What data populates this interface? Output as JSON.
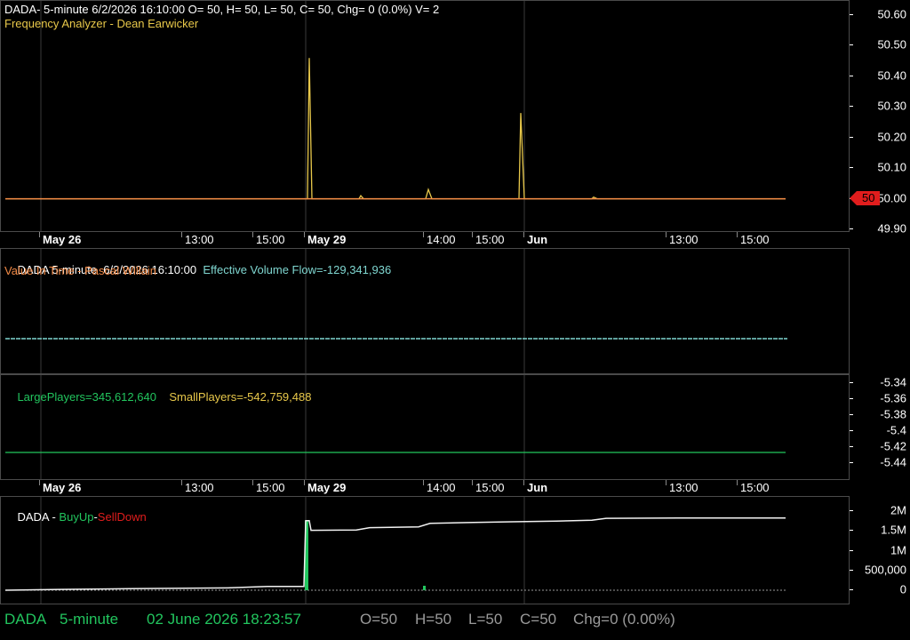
{
  "colors": {
    "green": "#22c55e",
    "yellow": "#e8c84a",
    "orange": "#f28a46",
    "cyan": "#7fd6d0",
    "red": "#e11d1d",
    "gray": "#9a9a9a"
  },
  "panel1": {
    "header": "DADA- 5-minute 6/2/2026 16:10:00 O= 50, H= 50, L= 50, C= 50, Chg= 0 (0.0%) V= 2",
    "subtitle": "Frequency Analyzer - Dean Earwicker",
    "last_value": "50"
  },
  "time_axis": {
    "labels": [
      {
        "text": "May 26",
        "bold": true
      },
      {
        "text": "13:00",
        "bold": false
      },
      {
        "text": "15:00",
        "bold": false
      },
      {
        "text": "May 29",
        "bold": true
      },
      {
        "text": "14:00",
        "bold": false
      },
      {
        "text": "15:00",
        "bold": false
      },
      {
        "text": "Jun",
        "bold": true
      },
      {
        "text": "13:00",
        "bold": false
      },
      {
        "text": "15:00",
        "bold": false
      }
    ]
  },
  "panel2": {
    "header_a": "DADA 5-minute  6/2/2026 16:10:00",
    "header_b": "Effective Volume Flow=-129,341,936",
    "subtitle": "Value In Time - Pascal Willain"
  },
  "panel3": {
    "large_label": "LargePlayers=345,612,640",
    "small_label": "SmallPlayers=-542,759,488"
  },
  "panel4": {
    "ticker": "DADA",
    "sep1": " - ",
    "buy": "BuyUp",
    "sep2": "-",
    "sell": "SellDown"
  },
  "status": {
    "symbol": "DADA",
    "interval": "5-minute",
    "datetime": "02 June 2026 18:23:57",
    "o": "O=50",
    "h": "H=50",
    "l": "L=50",
    "c": "C=50",
    "chg": "Chg=0 (0.00%)"
  },
  "chart_data": [
    {
      "type": "line",
      "y_ticks": [
        "50.60",
        "50.50",
        "50.40",
        "50.30",
        "50.20",
        "50.10",
        "50.00",
        "49.90"
      ],
      "ylim": [
        49.9,
        50.6
      ],
      "series": [
        {
          "points": [
            [
              0,
              50
            ],
            [
              340,
              50
            ],
            [
              342,
              50.46
            ],
            [
              345,
              50
            ],
            [
              398,
              50
            ],
            [
              400,
              50.01
            ],
            [
              403,
              50
            ],
            [
              473,
              50
            ],
            [
              476,
              50.03
            ],
            [
              480,
              50
            ],
            [
              578,
              50
            ],
            [
              580,
              50.28
            ],
            [
              584,
              50
            ],
            [
              660,
              50
            ],
            [
              662,
              50.005
            ],
            [
              666,
              50
            ],
            [
              878,
              50
            ]
          ]
        }
      ]
    },
    {
      "type": "line",
      "y_ticks": [
        "-5.34",
        "-5.36",
        "-5.38",
        "-5.4",
        "-5.42",
        "-5.44"
      ],
      "ylim": [
        -5.452,
        -5.328
      ],
      "series": [
        {
          "name": "LargePlayers"
        },
        {
          "name": "SmallPlayers"
        }
      ]
    },
    {
      "type": "line",
      "y_ticks": [
        "2M",
        "1.5M",
        "1M",
        "500,000",
        "0"
      ],
      "ylim": [
        0,
        2300000
      ],
      "series": [
        {
          "name": "BuyUp",
          "points": [
            [
              0,
              0
            ],
            [
              60,
              20000
            ],
            [
              140,
              40000
            ],
            [
              250,
              60000
            ],
            [
              295,
              100000
            ],
            [
              336,
              100000
            ],
            [
              338,
              1800000
            ],
            [
              342,
              1800000
            ],
            [
              344,
              1550000
            ],
            [
              395,
              1560000
            ],
            [
              410,
              1620000
            ],
            [
              465,
              1640000
            ],
            [
              478,
              1730000
            ],
            [
              520,
              1750000
            ],
            [
              570,
              1770000
            ],
            [
              620,
              1790000
            ],
            [
              660,
              1810000
            ],
            [
              676,
              1860000
            ],
            [
              760,
              1870000
            ],
            [
              878,
              1870000
            ]
          ]
        },
        {
          "name": "SellDown"
        }
      ]
    }
  ]
}
